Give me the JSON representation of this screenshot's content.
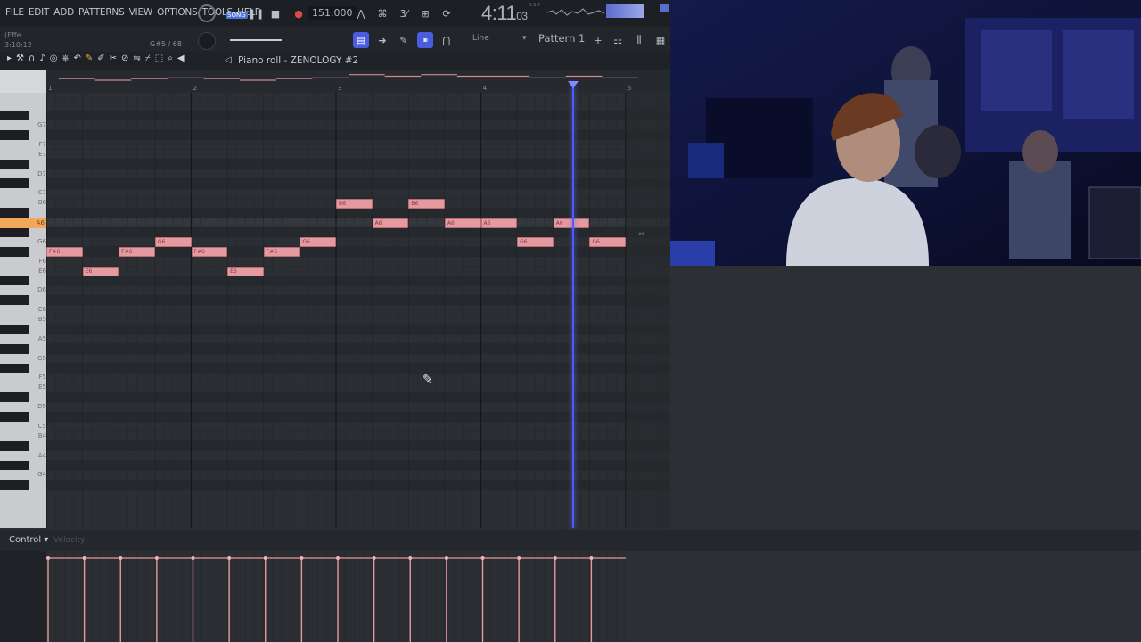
{
  "menu": [
    "FILE",
    "EDIT",
    "ADD",
    "PATTERNS",
    "VIEW",
    "OPTIONS",
    "TOOLS",
    "HELP"
  ],
  "transport": {
    "mode": "SONG",
    "tempo": "151.000",
    "time_main": "4:11",
    "time_sub": "03",
    "time_unit": "B:S:T"
  },
  "hint": {
    "line1": "(Effe",
    "line2": "3:10:12",
    "note": "G#5 / 68"
  },
  "snap": {
    "label": "Line"
  },
  "pattern": {
    "label": "Pattern 1"
  },
  "piano_roll": {
    "title": "Piano roll - ZENOLOGY #2"
  },
  "ruler": [
    "1",
    "2",
    "3",
    "4",
    "5"
  ],
  "key_labels": [
    "G7",
    "F7",
    "E7",
    "D7",
    "C7",
    "B6",
    "A6",
    "G6",
    "F6",
    "E6",
    "D6",
    "C6",
    "B5",
    "A5",
    "G5",
    "F5",
    "E5",
    "D5",
    "C5",
    "B4",
    "A4",
    "G4"
  ],
  "highlight_key": "A6",
  "notes": [
    {
      "label": "F#6",
      "pitch": "F#6",
      "start": 1.0,
      "len": 0.25
    },
    {
      "label": "E6",
      "pitch": "E6",
      "start": 1.25,
      "len": 0.25
    },
    {
      "label": "F#6",
      "pitch": "F#6",
      "start": 1.5,
      "len": 0.25
    },
    {
      "label": "G6",
      "pitch": "G6",
      "start": 1.75,
      "len": 0.25
    },
    {
      "label": "F#6",
      "pitch": "F#6",
      "start": 2.0,
      "len": 0.25
    },
    {
      "label": "E6",
      "pitch": "E6",
      "start": 2.25,
      "len": 0.25
    },
    {
      "label": "F#6",
      "pitch": "F#6",
      "start": 2.5,
      "len": 0.25
    },
    {
      "label": "G6",
      "pitch": "G6",
      "start": 2.75,
      "len": 0.25
    },
    {
      "label": "B6",
      "pitch": "B6",
      "start": 3.0,
      "len": 0.25
    },
    {
      "label": "A6",
      "pitch": "A6",
      "start": 3.25,
      "len": 0.25
    },
    {
      "label": "B6",
      "pitch": "B6",
      "start": 3.5,
      "len": 0.25
    },
    {
      "label": "A6",
      "pitch": "A6",
      "start": 3.75,
      "len": 0.25
    },
    {
      "label": "A6",
      "pitch": "A6",
      "start": 4.0,
      "len": 0.25
    },
    {
      "label": "G6",
      "pitch": "G6",
      "start": 4.25,
      "len": 0.25
    },
    {
      "label": "A6",
      "pitch": "A6",
      "start": 4.5,
      "len": 0.25
    },
    {
      "label": "G6",
      "pitch": "G6",
      "start": 4.75,
      "len": 0.25
    }
  ],
  "playhead_bar": 4.63,
  "control": {
    "label": "Control",
    "sub": "Velocity"
  },
  "colors": {
    "note": "#e59aa0",
    "playhead": "#4a5cff",
    "highlight": "#f0a85a"
  }
}
